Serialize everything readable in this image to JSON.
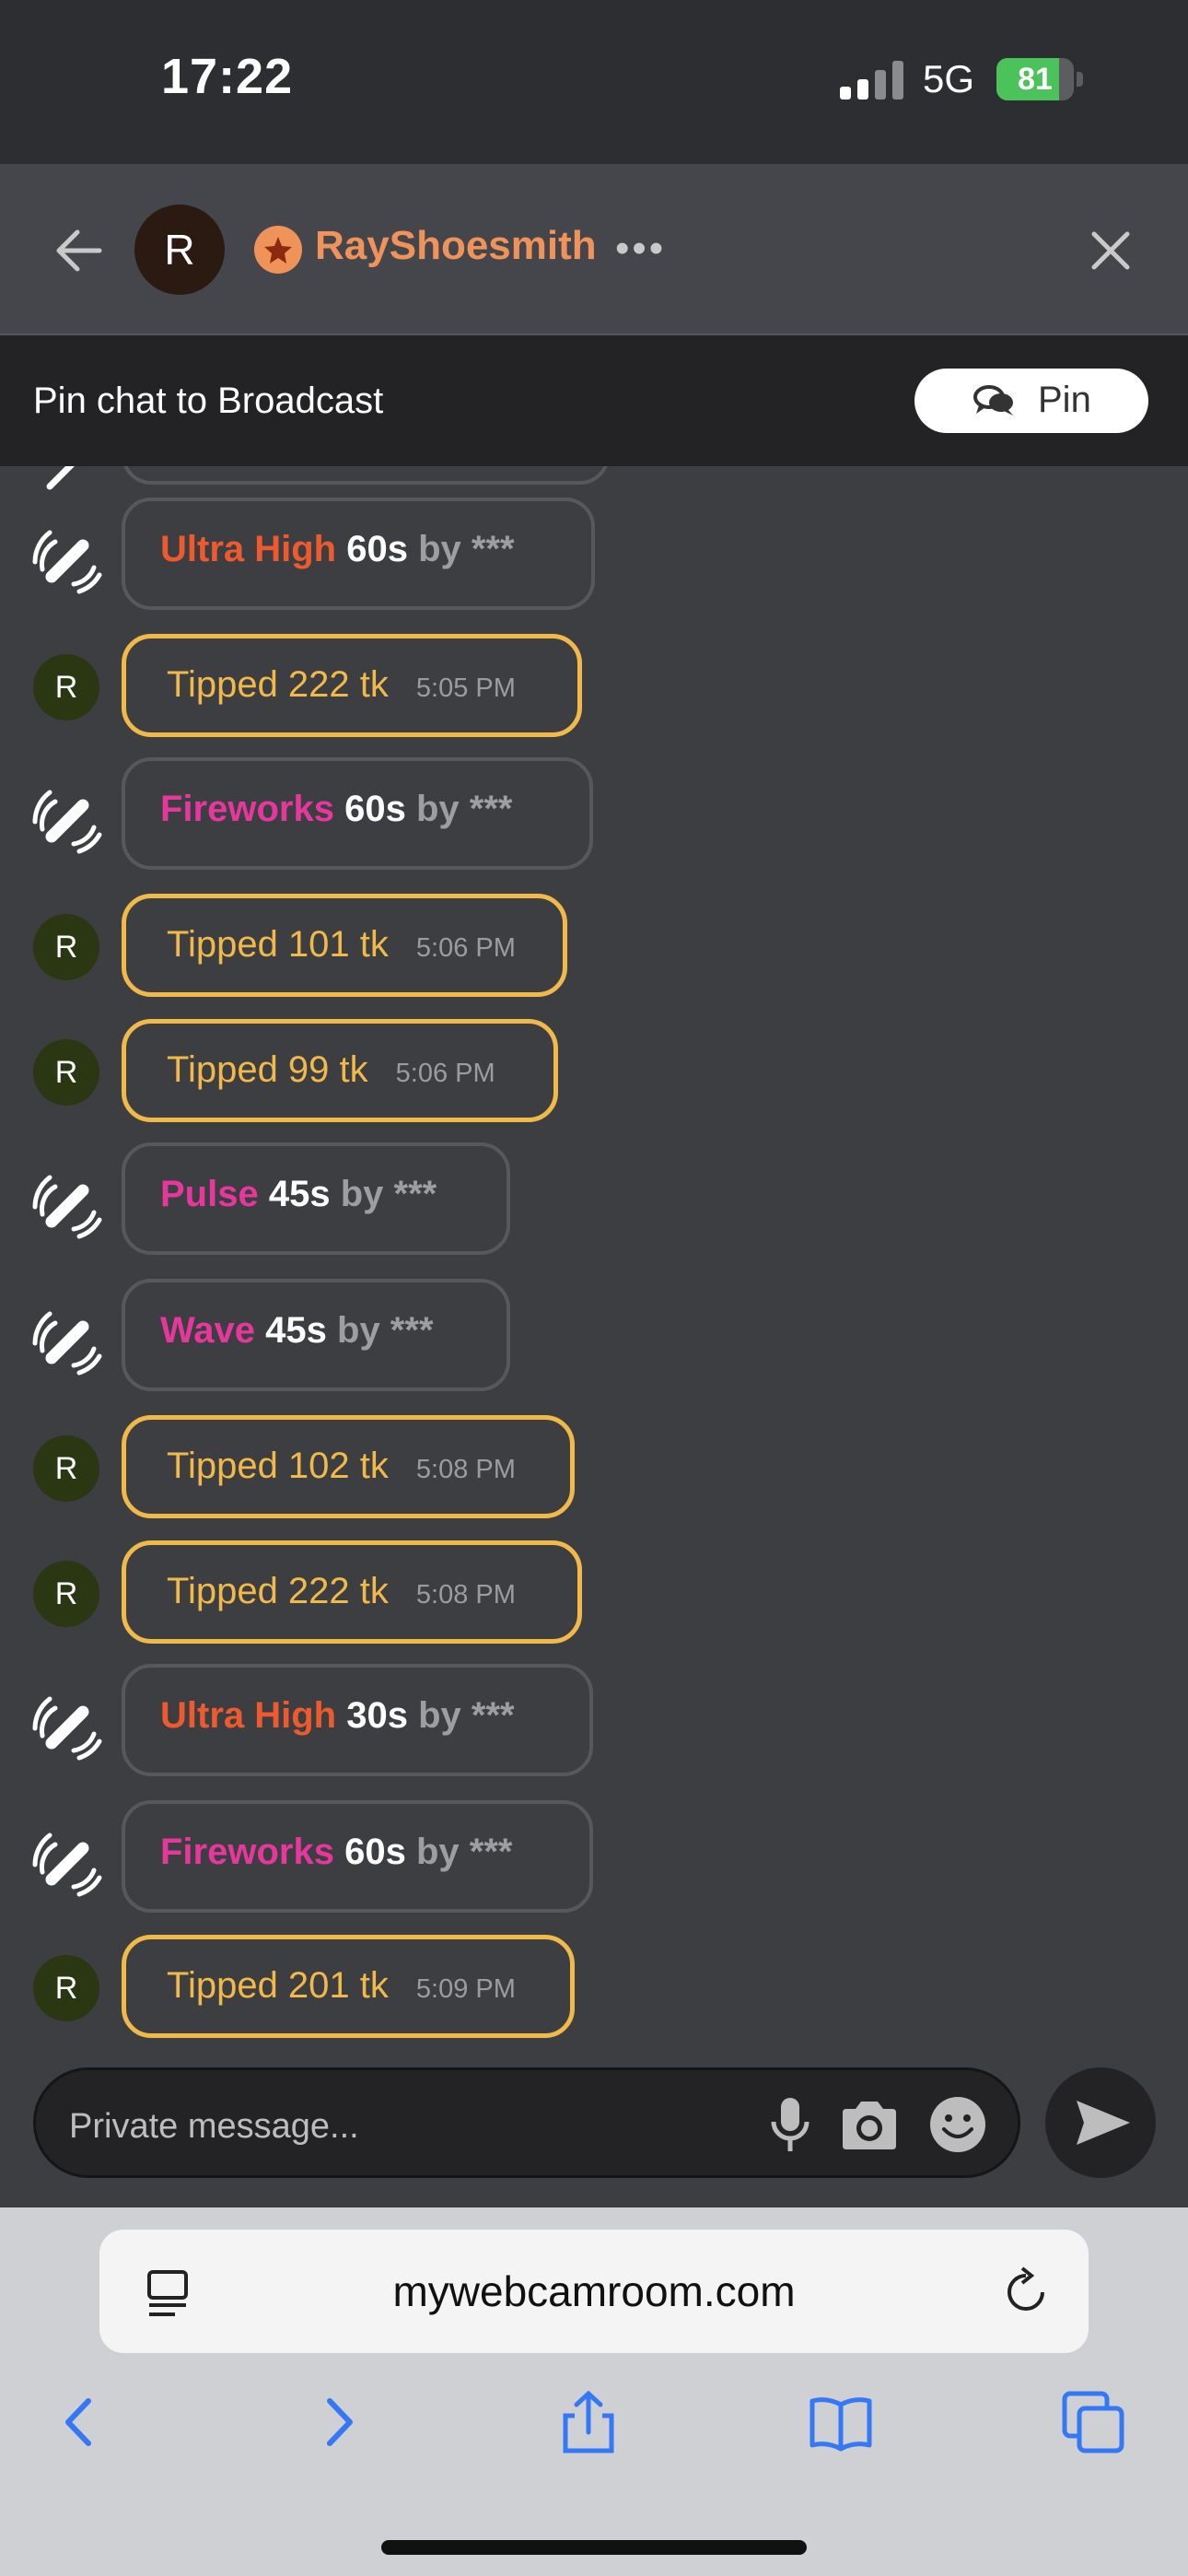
{
  "status": {
    "time": "17:22",
    "network": "5G",
    "battery": "81",
    "battery_level": 0.81
  },
  "header": {
    "avatar_letter": "R",
    "username": "RayShoesmith",
    "more": "•••"
  },
  "pin_bar": {
    "label": "Pin chat to Broadcast",
    "button": "Pin"
  },
  "messages": [
    {
      "type": "lovense",
      "name": "Ultra High",
      "name_color": "red",
      "duration": "60s",
      "by": "by ***"
    },
    {
      "type": "tip",
      "avatar": "R",
      "text": "Tipped 222 tk",
      "time": "5:05 PM"
    },
    {
      "type": "lovense",
      "name": "Fireworks",
      "name_color": "pink",
      "duration": "60s",
      "by": "by ***"
    },
    {
      "type": "tip",
      "avatar": "R",
      "text": "Tipped 101 tk",
      "time": "5:06 PM"
    },
    {
      "type": "tip",
      "avatar": "R",
      "text": "Tipped 99 tk",
      "time": "5:06 PM"
    },
    {
      "type": "lovense",
      "name": "Pulse",
      "name_color": "pink",
      "duration": "45s",
      "by": "by ***"
    },
    {
      "type": "lovense",
      "name": "Wave",
      "name_color": "pink",
      "duration": "45s",
      "by": "by ***"
    },
    {
      "type": "tip",
      "avatar": "R",
      "text": "Tipped 102 tk",
      "time": "5:08 PM"
    },
    {
      "type": "tip",
      "avatar": "R",
      "text": "Tipped 222 tk",
      "time": "5:08 PM"
    },
    {
      "type": "lovense",
      "name": "Ultra High",
      "name_color": "red",
      "duration": "30s",
      "by": "by ***"
    },
    {
      "type": "lovense",
      "name": "Fireworks",
      "name_color": "pink",
      "duration": "60s",
      "by": "by ***"
    },
    {
      "type": "tip",
      "avatar": "R",
      "text": "Tipped 201 tk",
      "time": "5:09 PM"
    }
  ],
  "composer": {
    "placeholder": "Private message..."
  },
  "browser": {
    "url": "mywebcamroom.com"
  },
  "icons": {
    "toy": "vibration-toy-icon",
    "back": "back-arrow-icon",
    "close": "close-icon",
    "mic": "microphone-icon",
    "camera": "camera-icon",
    "emoji": "emoji-icon",
    "send": "send-icon"
  },
  "colors": {
    "tip": "#f0b94a",
    "lovense_red": "#ec5a2d",
    "lovense_pink": "#e5379c",
    "username": "#f0935a"
  }
}
